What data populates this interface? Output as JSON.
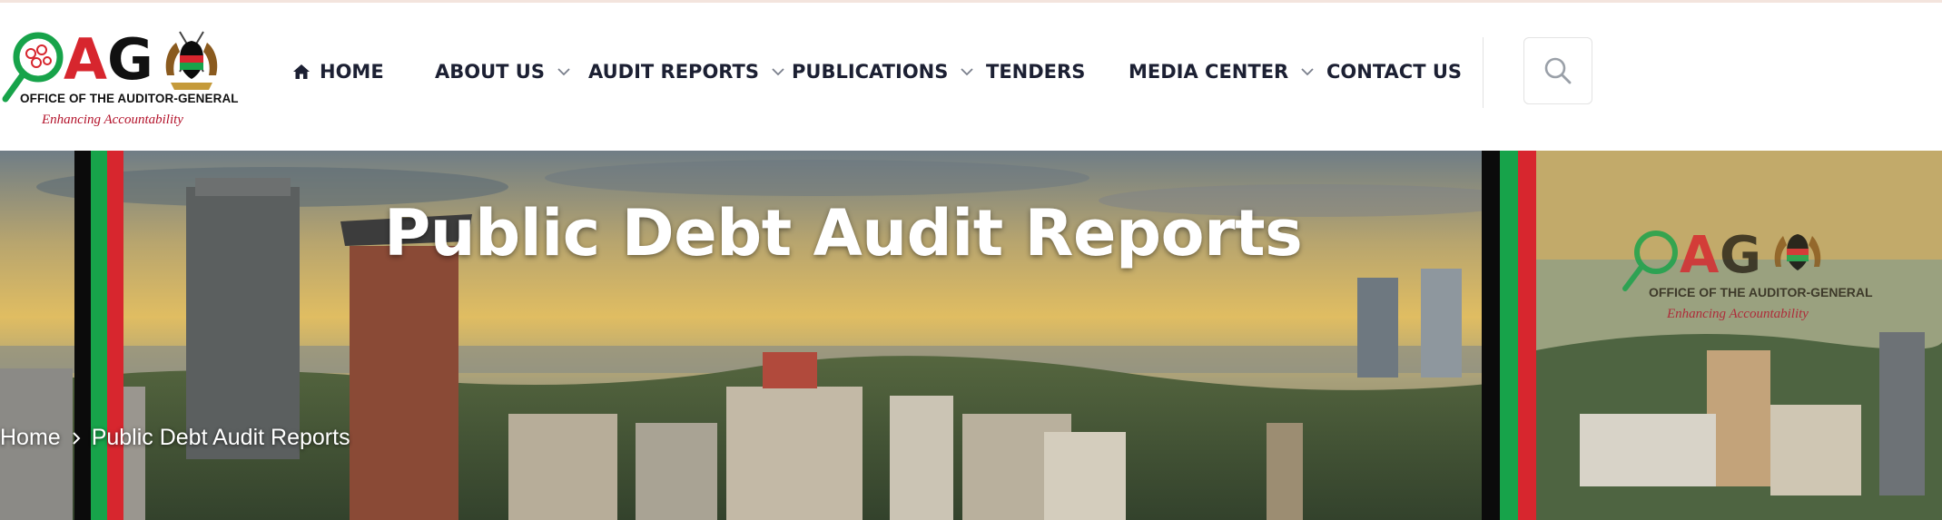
{
  "logo": {
    "letters": "OAG",
    "org_name": "OFFICE OF THE AUDITOR-GENERAL",
    "tagline": "Enhancing Accountability"
  },
  "nav": {
    "items": [
      {
        "label": "HOME",
        "icon": "home-icon"
      },
      {
        "label": "ABOUT US",
        "dropdown": true
      },
      {
        "label": "AUDIT REPORTS",
        "dropdown": true
      },
      {
        "label": "PUBLICATIONS",
        "dropdown": true
      },
      {
        "label": "TENDERS"
      },
      {
        "label": "MEDIA CENTER",
        "dropdown": true
      },
      {
        "label": "CONTACT US"
      }
    ],
    "search_icon": "search-icon"
  },
  "hero": {
    "title": "Public Debt Audit Reports",
    "breadcrumb": [
      "Home",
      "Public Debt Audit Reports"
    ],
    "watermark": {
      "letters": "OAG",
      "org_name": "OFFICE OF THE AUDITOR-GENERAL",
      "tagline": "Enhancing Accountability"
    }
  },
  "colors": {
    "green": "#17a34a",
    "red": "#d7262e",
    "black": "#0b0b0b",
    "nav_text": "#1c2033"
  }
}
